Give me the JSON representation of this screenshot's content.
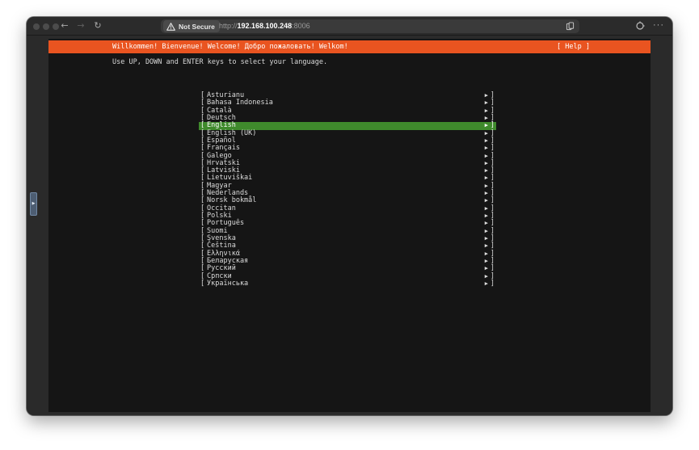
{
  "browser": {
    "security_label": "Not Secure",
    "url_scheme": "http://",
    "url_host": "192.168.100.248",
    "url_port": ":8006",
    "back_glyph": "←",
    "forward_glyph": "→",
    "reload_glyph": "↻",
    "more_glyph": "···"
  },
  "installer": {
    "header_title": "Willkommen! Bienvenue! Welcome! Добро пожаловать! Welkom!",
    "help_label": "[ Help ]",
    "instructions": "Use UP, DOWN and ENTER keys to select your language.",
    "accent_color": "#e95420",
    "selected_color": "#3f8a2c",
    "bracket_open": "[",
    "bracket_close": "]",
    "arrow": "▶",
    "selected_index": 4,
    "languages": [
      "Asturianu",
      "Bahasa Indonesia",
      "Català",
      "Deutsch",
      "English",
      "English (UK)",
      "Español",
      "Français",
      "Galego",
      "Hrvatski",
      "Latviski",
      "Lietuviškai",
      "Magyar",
      "Nederlands",
      "Norsk bokmål",
      "Occitan",
      "Polski",
      "Português",
      "Suomi",
      "Svenska",
      "Čeština",
      "Ελληνικά",
      "Беларуская",
      "Русский",
      "Српски",
      "Українська"
    ]
  }
}
